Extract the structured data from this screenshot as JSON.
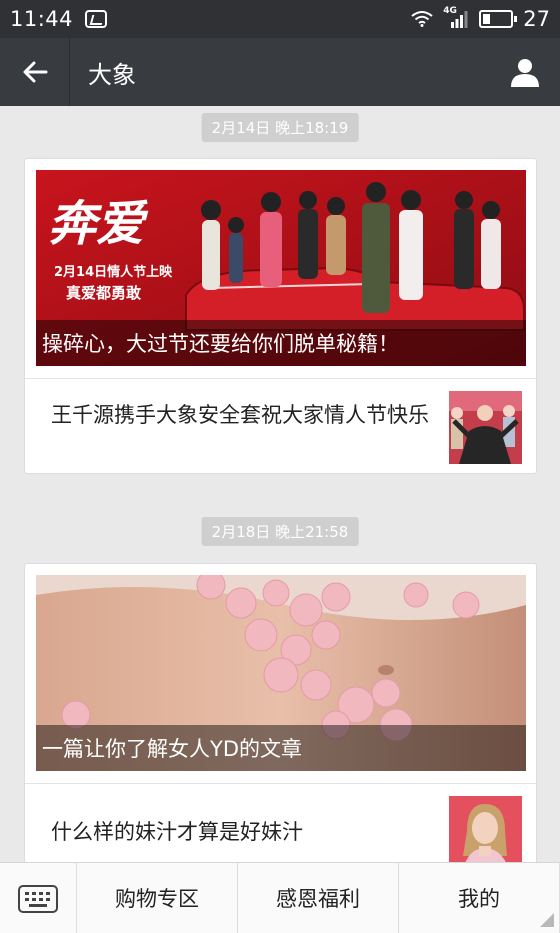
{
  "status_bar": {
    "time": "11:44",
    "network_label": "4G",
    "battery_percent": "27",
    "battery_level": 0.27,
    "icons": [
      "app-notification-icon",
      "wifi-icon",
      "signal-icon",
      "battery-icon"
    ]
  },
  "nav": {
    "title": "大象",
    "back_icon": "arrow-left-icon",
    "profile_icon": "person-icon"
  },
  "messages": [
    {
      "timestamp": "2月14日 晚上18:19",
      "cover_caption": "操碎心，大过节还要给你们脱单秘籍！",
      "cover_poster_title": "奔爱",
      "cover_poster_line1": "2月14日情人节上映",
      "cover_poster_line2": "真爱都勇敢",
      "sub_item_title": "王千源携手大象安全套祝大家情人节快乐"
    },
    {
      "timestamp": "2月18日 晚上21:58",
      "cover_caption": "一篇让你了解女人YD的文章",
      "sub_item_title": "什么样的妹汁才算是好妹汁"
    }
  ],
  "bottom_menu": {
    "keyboard_icon": "keyboard-icon",
    "items": [
      "购物专区",
      "感恩福利",
      "我的"
    ]
  },
  "colors": {
    "status_bar_bg": "#2f3134",
    "nav_bg": "#383b3f",
    "page_bg": "#e9e9e9",
    "poster_red": "#b5121b"
  }
}
